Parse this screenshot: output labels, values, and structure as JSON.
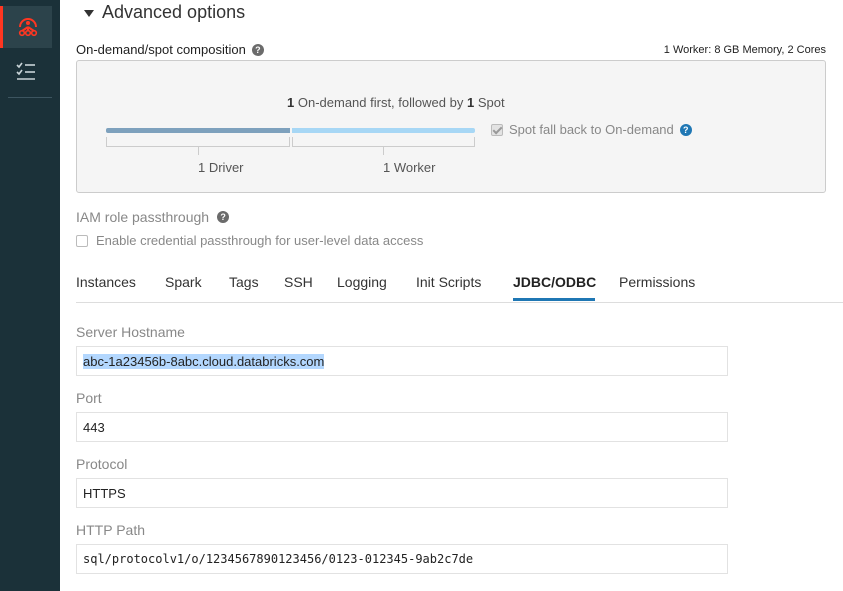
{
  "sidebar": {
    "items": [
      {
        "icon": "clusters-icon",
        "active": true
      },
      {
        "icon": "jobs-checklist-icon",
        "active": false
      }
    ]
  },
  "advanced": {
    "title": "Advanced options"
  },
  "composition": {
    "label": "On-demand/spot composition",
    "worker_spec": "1 Worker: 8 GB Memory, 2 Cores",
    "caption_count1": "1",
    "caption_mid": "On-demand first, followed by",
    "caption_count2": "1",
    "caption_end": "Spot",
    "driver_label": "1 Driver",
    "worker_label": "1 Worker",
    "spot_fallback_label": "Spot fall back to On-demand",
    "spot_fallback_checked": true
  },
  "iam": {
    "label": "IAM role passthrough",
    "checkbox_label": "Enable credential passthrough for user-level data access",
    "checked": false
  },
  "tabs": [
    {
      "label": "Instances"
    },
    {
      "label": "Spark"
    },
    {
      "label": "Tags"
    },
    {
      "label": "SSH"
    },
    {
      "label": "Logging"
    },
    {
      "label": "Init Scripts"
    },
    {
      "label": "JDBC/ODBC",
      "active": true
    },
    {
      "label": "Permissions"
    }
  ],
  "jdbc": {
    "hostname_label": "Server Hostname",
    "hostname_value": "abc-1a23456b-8abc.cloud.databricks.com",
    "port_label": "Port",
    "port_value": "443",
    "protocol_label": "Protocol",
    "protocol_value": "HTTPS",
    "path_label": "HTTP Path",
    "path_value": "sql/protocolv1/o/1234567890123456/0123-012345-9ab2c7de"
  },
  "colors": {
    "sidebar_bg": "#1b3139",
    "accent_red": "#ff3621",
    "tab_active": "#1f77b4",
    "driver_bar": "#7ea1bd",
    "worker_bar": "#a7d7f5"
  }
}
